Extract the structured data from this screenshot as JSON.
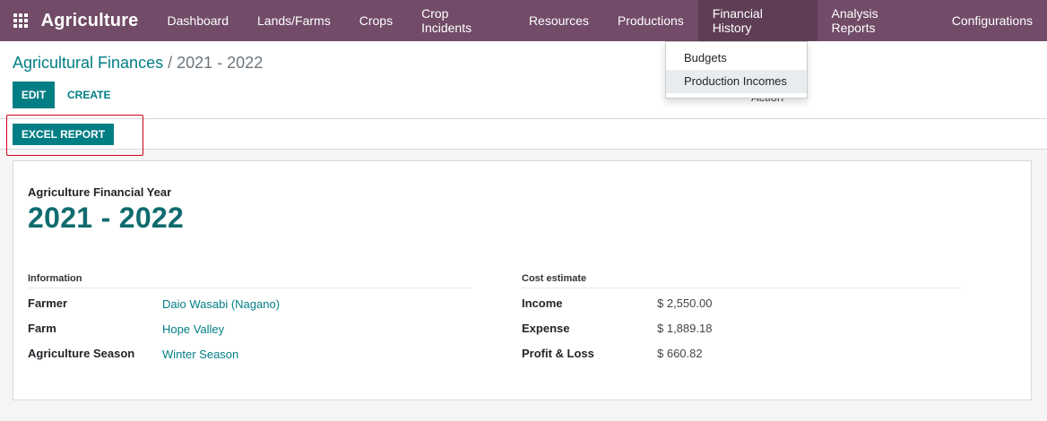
{
  "navbar": {
    "app_title": "Agriculture",
    "menu": [
      "Dashboard",
      "Lands/Farms",
      "Crops",
      "Crop Incidents",
      "Resources",
      "Productions",
      "Financial History",
      "Analysis Reports",
      "Configurations"
    ]
  },
  "dropdown": {
    "items": [
      "Budgets",
      "Production Incomes"
    ]
  },
  "breadcrumb": {
    "parent": "Agricultural Finances",
    "separator": "/",
    "current": "2021 - 2022"
  },
  "buttons": {
    "edit": "EDIT",
    "create": "CREATE",
    "action_partial": "Action",
    "excel_report": "EXCEL REPORT"
  },
  "form": {
    "year_label": "Agriculture Financial Year",
    "year_value": "2021 - 2022",
    "information": {
      "title": "Information",
      "farmer_label": "Farmer",
      "farmer_value": "Daio Wasabi (Nagano)",
      "farm_label": "Farm",
      "farm_value": "Hope Valley",
      "season_label": "Agriculture Season",
      "season_value": "Winter Season"
    },
    "cost_estimate": {
      "title": "Cost estimate",
      "income_label": "Income",
      "income_value": "$ 2,550.00",
      "expense_label": "Expense",
      "expense_value": "$ 1,889.18",
      "profit_label": "Profit & Loss",
      "profit_value": "$ 660.82"
    }
  },
  "colors": {
    "navbar": "#714b67",
    "accent": "#017e84",
    "highlight": "#d0021b"
  }
}
